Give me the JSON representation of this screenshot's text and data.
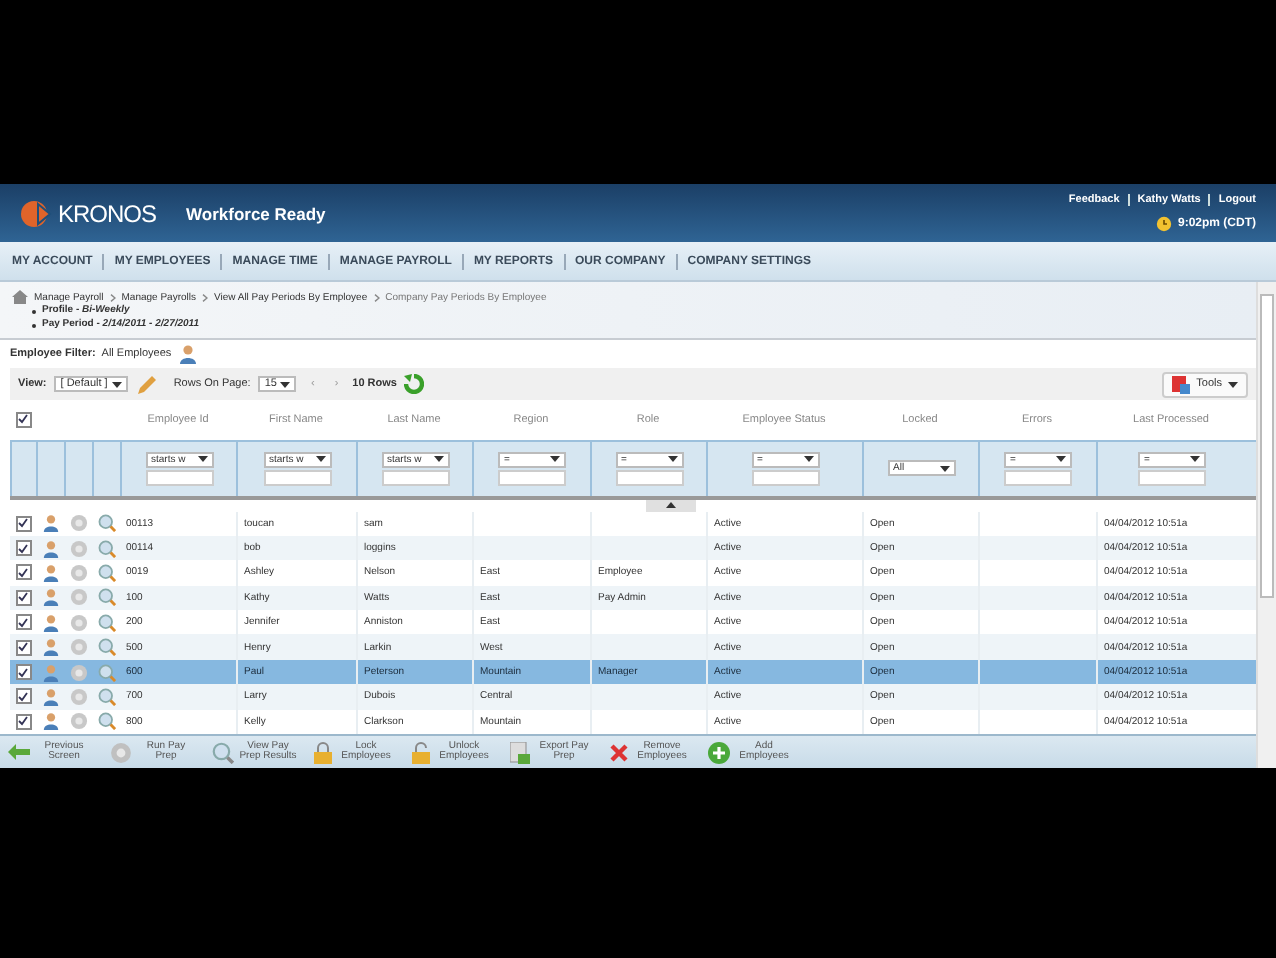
{
  "header": {
    "logo": "KRONOS",
    "product": "Workforce Ready",
    "links": [
      "Feedback",
      "Kathy Watts",
      "Logout"
    ],
    "time": "9:02pm (CDT)"
  },
  "nav": [
    "MY ACCOUNT",
    "MY EMPLOYEES",
    "MANAGE TIME",
    "MANAGE PAYROLL",
    "MY REPORTS",
    "OUR COMPANY",
    "COMPANY SETTINGS"
  ],
  "breadcrumb": [
    "Manage Payroll",
    "Manage Payrolls",
    "View All Pay Periods By Employee",
    "Company Pay Periods By Employee"
  ],
  "details": [
    {
      "label": "Profile - ",
      "value": "Bi-Weekly"
    },
    {
      "label": "Pay Period - ",
      "value": "2/14/2011 - 2/27/2011"
    }
  ],
  "employee_filter": {
    "label": "Employee Filter:",
    "value": "All Employees"
  },
  "toolbar": {
    "view_label": "View:",
    "view": "[ Default ]",
    "rows_label": "Rows On Page:",
    "rows": "15",
    "prev": "‹",
    "next": "›",
    "count": "10 Rows",
    "tools": "Tools"
  },
  "table": {
    "select_all": true,
    "columns": [
      {
        "label": "Employee Id",
        "kind": "text",
        "filter": "starts w"
      },
      {
        "label": "First Name",
        "kind": "text",
        "filter": "starts w"
      },
      {
        "label": "Last Name",
        "kind": "text",
        "filter": "starts w"
      },
      {
        "label": "Region",
        "kind": "text",
        "filter": "="
      },
      {
        "label": "Role",
        "kind": "text",
        "filter": "="
      },
      {
        "label": "Employee Status",
        "kind": "text",
        "filter": "="
      },
      {
        "label": "Locked",
        "kind": "select",
        "filter": "All"
      },
      {
        "label": "Errors",
        "kind": "text",
        "filter": "="
      },
      {
        "label": "Last Processed",
        "kind": "text",
        "filter": "="
      }
    ],
    "rows": [
      {
        "checked": true,
        "selected": false,
        "cells": [
          "00113",
          "toucan",
          "sam",
          "",
          "",
          "Active",
          "Open",
          "",
          "04/04/2012 10:51a"
        ]
      },
      {
        "checked": true,
        "selected": false,
        "cells": [
          "00114",
          "bob",
          "loggins",
          "",
          "",
          "Active",
          "Open",
          "",
          "04/04/2012 10:51a"
        ]
      },
      {
        "checked": true,
        "selected": false,
        "cells": [
          "0019",
          "Ashley",
          "Nelson",
          "East",
          "Employee",
          "Active",
          "Open",
          "",
          "04/04/2012 10:51a"
        ]
      },
      {
        "checked": true,
        "selected": false,
        "cells": [
          "100",
          "Kathy",
          "Watts",
          "East",
          "Pay Admin",
          "Active",
          "Open",
          "",
          "04/04/2012 10:51a"
        ]
      },
      {
        "checked": true,
        "selected": false,
        "cells": [
          "200",
          "Jennifer",
          "Anniston",
          "East",
          "",
          "Active",
          "Open",
          "",
          "04/04/2012 10:51a"
        ]
      },
      {
        "checked": true,
        "selected": false,
        "cells": [
          "500",
          "Henry",
          "Larkin",
          "West",
          "",
          "Active",
          "Open",
          "",
          "04/04/2012 10:51a"
        ]
      },
      {
        "checked": true,
        "selected": true,
        "cells": [
          "600",
          "Paul",
          "Peterson",
          "Mountain",
          "Manager",
          "Active",
          "Open",
          "",
          "04/04/2012 10:51a"
        ]
      },
      {
        "checked": true,
        "selected": false,
        "cells": [
          "700",
          "Larry",
          "Dubois",
          "Central",
          "",
          "Active",
          "Open",
          "",
          "04/04/2012 10:51a"
        ]
      },
      {
        "checked": true,
        "selected": false,
        "cells": [
          "800",
          "Kelly",
          "Clarkson",
          "Mountain",
          "",
          "Active",
          "Open",
          "",
          "04/04/2012 10:51a"
        ]
      }
    ]
  },
  "actions": [
    {
      "kind": "back",
      "label": "Previous Screen"
    },
    {
      "kind": "gear",
      "label": "Run Pay Prep"
    },
    {
      "kind": "search",
      "label": "View Pay Prep Results"
    },
    {
      "kind": "lock",
      "label": "Lock Employees"
    },
    {
      "kind": "unlock",
      "label": "Unlock Employees"
    },
    {
      "kind": "export",
      "label": "Export Pay Prep"
    },
    {
      "kind": "remove",
      "label": "Remove Employees"
    },
    {
      "kind": "add",
      "label": "Add Employees"
    }
  ]
}
